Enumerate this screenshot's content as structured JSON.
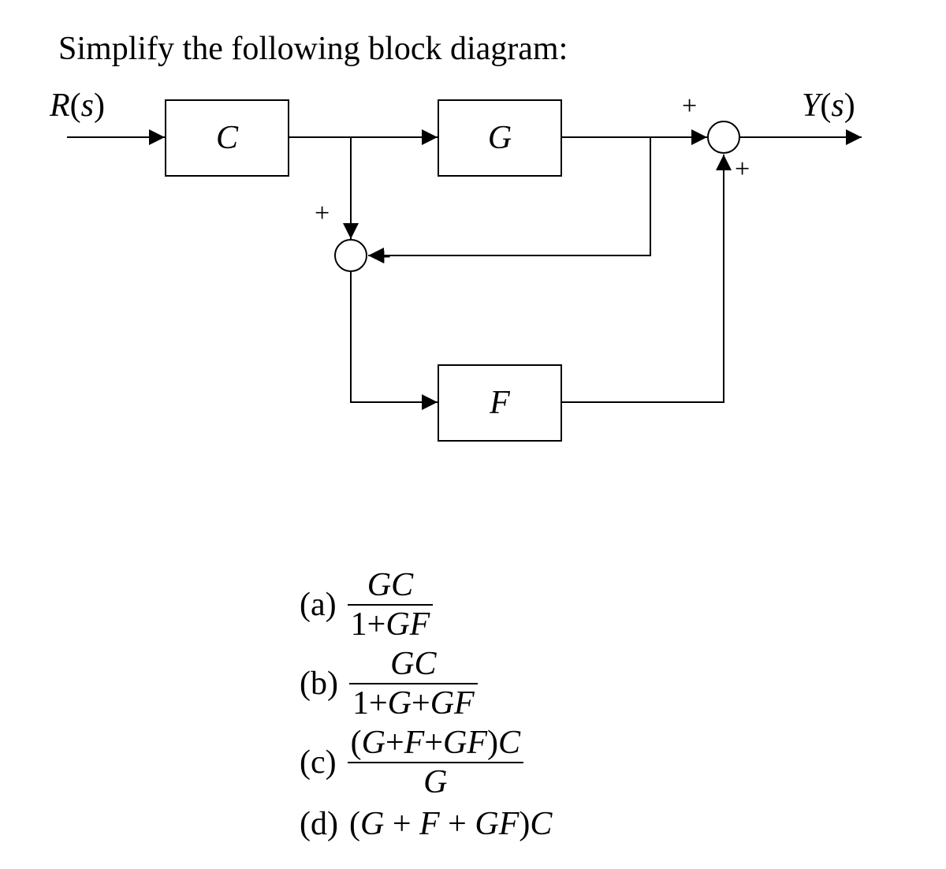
{
  "prompt": "Simplify the following block diagram:",
  "diagram": {
    "input_label": "R(s)",
    "output_label": "Y(s)",
    "blocks": {
      "C": "C",
      "G": "G",
      "F": "F"
    },
    "summing_junctions": {
      "inner": {
        "sign_top": "+",
        "sign_right": "+"
      },
      "output": {
        "sign_top": "+",
        "sign_bottom": "+"
      }
    }
  },
  "answers": {
    "a": {
      "label": "(a)",
      "num": "GC",
      "den": "1+GF"
    },
    "b": {
      "label": "(b)",
      "num": "GC",
      "den": "1+G+GF"
    },
    "c": {
      "label": "(c)",
      "num": "(G+F+GF)C",
      "den": "G"
    },
    "d": {
      "label": "(d)",
      "expr": "(G + F + GF)C"
    }
  }
}
